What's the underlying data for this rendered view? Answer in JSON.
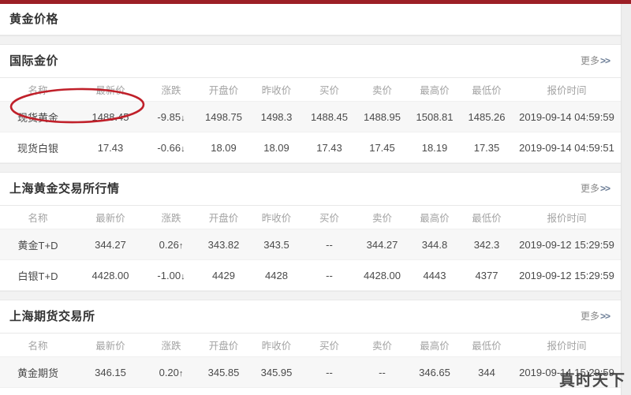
{
  "page": {
    "title": "黄金价格",
    "accent_color": "#9c1f26",
    "watermark": "真时天下"
  },
  "common": {
    "more_label": "更多",
    "more_chevron": ">>",
    "columns": [
      "名称",
      "最新价",
      "涨跌",
      "开盘价",
      "昨收价",
      "买价",
      "卖价",
      "最高价",
      "最低价",
      "报价时间"
    ],
    "up_arrow": "↑",
    "down_arrow": "↓",
    "dash": "--",
    "up_color": "#c0392b",
    "down_color": "#3f8049"
  },
  "annotation": {
    "type": "ellipse",
    "color": "#c0202a",
    "target": "现货黄金 1488.45"
  },
  "sections": [
    {
      "id": "international-gold",
      "title": "国际金价",
      "rows": [
        {
          "name": "现货黄金",
          "last": "1488.45",
          "last_dir": "down",
          "change": "-9.85",
          "change_dir": "down",
          "open": "1498.75",
          "prev_close": "1498.3",
          "buy": "1488.45",
          "buy_dir": "down",
          "sell": "1488.95",
          "sell_dir": "down",
          "high": "1508.81",
          "low": "1485.26",
          "time": "2019-09-14 04:59:59"
        },
        {
          "name": "现货白银",
          "last": "17.43",
          "last_dir": "down",
          "change": "-0.66",
          "change_dir": "down",
          "open": "18.09",
          "prev_close": "18.09",
          "buy": "17.43",
          "buy_dir": "down",
          "sell": "17.45",
          "sell_dir": "down",
          "high": "18.19",
          "low": "17.35",
          "time": "2019-09-14 04:59:51"
        }
      ]
    },
    {
      "id": "shanghai-gold-exchange",
      "title": "上海黄金交易所行情",
      "rows": [
        {
          "name": "黄金T+D",
          "last": "344.27",
          "last_dir": "up",
          "change": "0.26",
          "change_dir": "up",
          "open": "343.82",
          "prev_close": "343.5",
          "buy": "--",
          "buy_dir": "dash",
          "sell": "344.27",
          "sell_dir": "up",
          "high": "344.8",
          "low": "342.3",
          "time": "2019-09-12 15:29:59"
        },
        {
          "name": "白银T+D",
          "last": "4428.00",
          "last_dir": "down",
          "change": "-1.00",
          "change_dir": "down",
          "open": "4429",
          "prev_close": "4428",
          "buy": "--",
          "buy_dir": "dash",
          "sell": "4428.00",
          "sell_dir": "down",
          "high": "4443",
          "low": "4377",
          "time": "2019-09-12 15:29:59"
        }
      ]
    },
    {
      "id": "shanghai-futures-exchange",
      "title": "上海期货交易所",
      "rows": [
        {
          "name": "黄金期货",
          "last": "346.15",
          "last_dir": "up",
          "change": "0.20",
          "change_dir": "up",
          "open": "345.85",
          "prev_close": "345.95",
          "buy": "--",
          "buy_dir": "dash",
          "sell": "--",
          "sell_dir": "dash",
          "high": "346.65",
          "low": "344",
          "time": "2019-09-14 15:29:59"
        }
      ]
    }
  ]
}
